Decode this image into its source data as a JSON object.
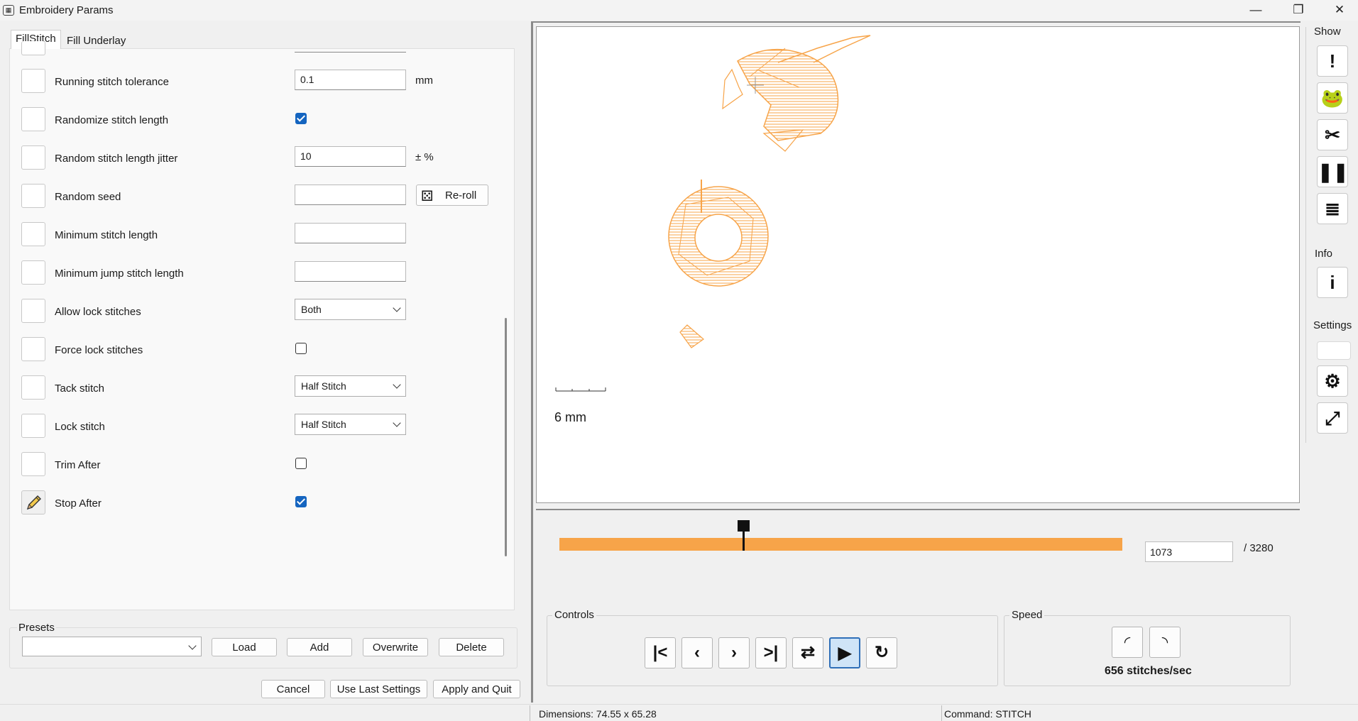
{
  "window": {
    "title": "Embroidery Params",
    "minimize_glyph": "—",
    "restore_glyph": "❐",
    "close_glyph": "✕"
  },
  "tabs": [
    {
      "label": "FillStitch",
      "active": true
    },
    {
      "label": "Fill Underlay",
      "active": false
    }
  ],
  "params": {
    "rows": [
      {
        "label": "Running stitch tolerance",
        "control": "text",
        "value": "0.1",
        "unit": "mm"
      },
      {
        "label": "Randomize stitch length",
        "control": "checkbox",
        "checked": true
      },
      {
        "label": "Random stitch length jitter",
        "control": "text",
        "value": "10",
        "unit": "± %"
      },
      {
        "label": "Random seed",
        "control": "text",
        "value": "",
        "button": "Re-roll"
      },
      {
        "label": "Minimum stitch length",
        "control": "text",
        "value": ""
      },
      {
        "label": "Minimum jump stitch length",
        "control": "text",
        "value": ""
      },
      {
        "label": "Allow lock stitches",
        "control": "dropdown",
        "value": "Both"
      },
      {
        "label": "Force lock stitches",
        "control": "checkbox",
        "checked": false
      },
      {
        "label": "Tack stitch",
        "control": "dropdown",
        "value": "Half Stitch"
      },
      {
        "label": "Lock stitch",
        "control": "dropdown",
        "value": "Half Stitch"
      },
      {
        "label": "Trim After",
        "control": "checkbox",
        "checked": false
      },
      {
        "label": "Stop After",
        "control": "checkbox",
        "checked": true,
        "edited": true
      }
    ]
  },
  "presets": {
    "title": "Presets",
    "selected": "",
    "load": "Load",
    "add": "Add",
    "overwrite": "Overwrite",
    "delete": "Delete"
  },
  "footer": {
    "cancel": "Cancel",
    "use_last": "Use Last Settings",
    "apply": "Apply and Quit"
  },
  "preview": {
    "scale_label": "6 mm",
    "stitch_color": "#f7a449",
    "current_stitch": "1073",
    "total_label": "/ 3280",
    "progress_fraction": 0.327
  },
  "controls": {
    "title": "Controls",
    "buttons": [
      "first",
      "previous",
      "next",
      "last",
      "swap",
      "play",
      "refresh"
    ]
  },
  "speed": {
    "title": "Speed",
    "label": "656 stitches/sec"
  },
  "sidebar": {
    "show_title": "Show",
    "info_title": "Info",
    "settings_title": "Settings"
  },
  "status": {
    "dimensions": "Dimensions: 74.55 x 65.28",
    "command": "Command: STITCH"
  }
}
